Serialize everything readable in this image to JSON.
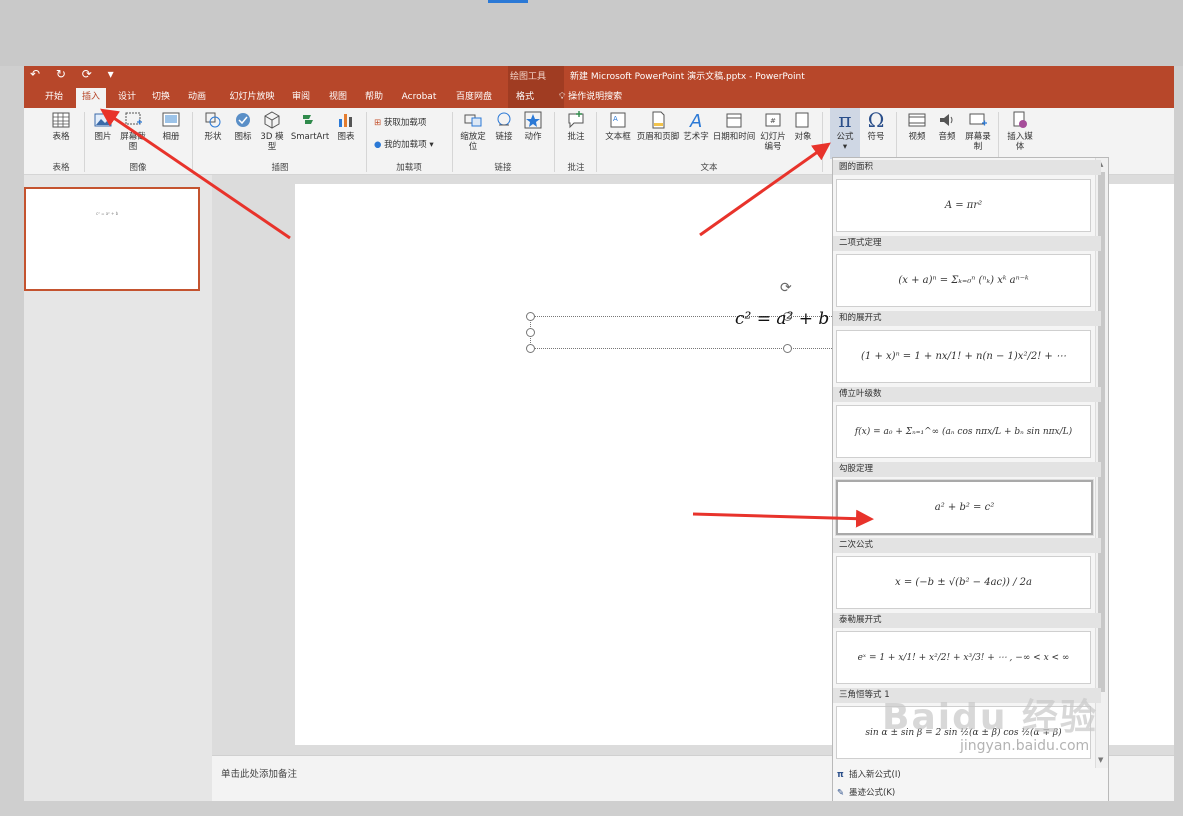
{
  "titlebar": {
    "quick_access": "↶ ↻ ⟳ ▾",
    "context_label": "绘图工具",
    "document_title": "新建 Microsoft PowerPoint 演示文稿.pptx  -  PowerPoint"
  },
  "tabs": [
    "开始",
    "插入",
    "设计",
    "切换",
    "动画",
    "幻灯片放映",
    "审阅",
    "视图",
    "帮助",
    "Acrobat",
    "百度网盘",
    "格式"
  ],
  "active_tab": "插入",
  "tell_me": "操作说明搜索",
  "ribbon": {
    "tables_label": "表格",
    "table_btn": "表格",
    "images_label": "图像",
    "picture_btn": "图片",
    "screenshot_btn": "屏幕截图",
    "album_btn": "相册",
    "illustrations_label": "插图",
    "shapes_btn": "形状",
    "icons_btn": "图标",
    "model_btn": "3D 模型",
    "smartart_btn": "SmartArt",
    "chart_btn": "图表",
    "addins_label": "加载项",
    "get_addins_btn": "获取加载项",
    "my_addins_btn": "我的加载项",
    "links_label": "链接",
    "zoom_btn": "缩放定位",
    "link_btn": "链接",
    "action_btn": "动作",
    "comments_label": "批注",
    "comment_btn": "批注",
    "text_label": "文本",
    "textbox_btn": "文本框",
    "header_btn": "页眉和页脚",
    "wordart_btn": "艺术字",
    "datetime_btn": "日期和时间",
    "slidenum_btn": "幻灯片编号",
    "object_btn": "对象",
    "equation_btn": "公式",
    "symbol_btn": "符号",
    "video_btn": "视频",
    "audio_btn": "音频",
    "screenrec_btn": "屏幕录制",
    "insertmedia_btn": "插入媒体"
  },
  "slide": {
    "equation": "c² = a² + b",
    "notes_placeholder": "单击此处添加备注"
  },
  "gallery": {
    "items": [
      {
        "title": "圆的面积",
        "formula": "A = πr²"
      },
      {
        "title": "二项式定理",
        "formula": "(x + a)ⁿ = Σₖ₌₀ⁿ (ⁿₖ) xᵏ aⁿ⁻ᵏ"
      },
      {
        "title": "和的展开式",
        "formula": "(1 + x)ⁿ = 1 + nx/1! + n(n − 1)x²/2! + ⋯"
      },
      {
        "title": "傅立叶级数",
        "formula": "f(x) = a₀ + Σₙ₌₁^∞ (aₙ cos nπx/L + bₙ sin nπx/L)"
      },
      {
        "title": "勾股定理",
        "formula": "a² + b² = c²"
      },
      {
        "title": "二次公式",
        "formula": "x = (−b ± √(b² − 4ac)) / 2a"
      },
      {
        "title": "泰勒展开式",
        "formula": "eˣ = 1 + x/1! + x²/2! + x³/3! + ⋯ ,    −∞ < x < ∞"
      },
      {
        "title": "三角恒等式 1",
        "formula": "sin α ± sin β = 2 sin ½(α ± β) cos ½(α ∓ β)"
      }
    ],
    "insert_new": "插入新公式(I)",
    "ink_equation": "墨迹公式(K)"
  },
  "watermark": {
    "brand": "Baidu 经验",
    "url": "jingyan.baidu.com"
  },
  "colors": {
    "accent": "#b7472a",
    "arrow": "#e8332b"
  }
}
